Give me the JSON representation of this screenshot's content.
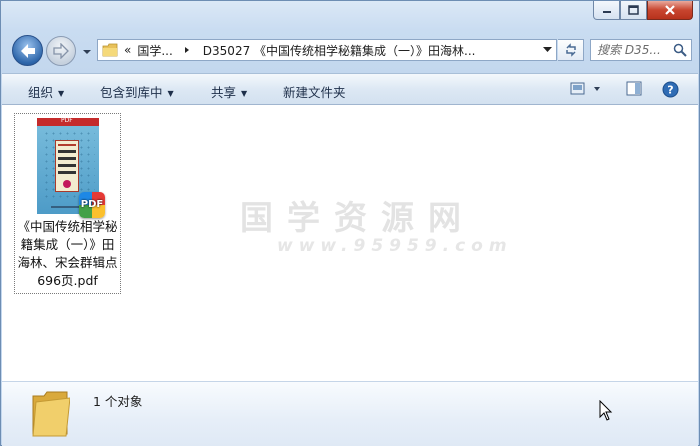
{
  "window": {
    "caption_buttons": {
      "minimize": "minimize",
      "maximize": "maximize",
      "close": "close"
    }
  },
  "address_bar": {
    "overflow_chevron": "«",
    "breadcrumbs": [
      "国学...",
      "D35027 《中国传统相学秘籍集成（一）》田海林..."
    ],
    "separator_icon": "triangle-right-icon"
  },
  "search": {
    "placeholder": "搜索 D35..."
  },
  "toolbar": {
    "organize": "组织",
    "include_in_library": "包含到库中",
    "share": "共享",
    "new_folder": "新建文件夹"
  },
  "content": {
    "watermark_title": "国学资源网",
    "watermark_url": "www.95959.com",
    "files": [
      {
        "name": "《中国传统相学秘籍集成（一）》田海林、宋会群辑点696页.pdf",
        "badge": "PDF",
        "cover_top_label": "PDF"
      }
    ]
  },
  "details": {
    "count_text": "1 个对象"
  },
  "colors": {
    "window_frame": "#c3d7ee",
    "close_button": "#c8452f",
    "back_button": "#2f67ab",
    "cover_blue": "#4d9bc7"
  }
}
